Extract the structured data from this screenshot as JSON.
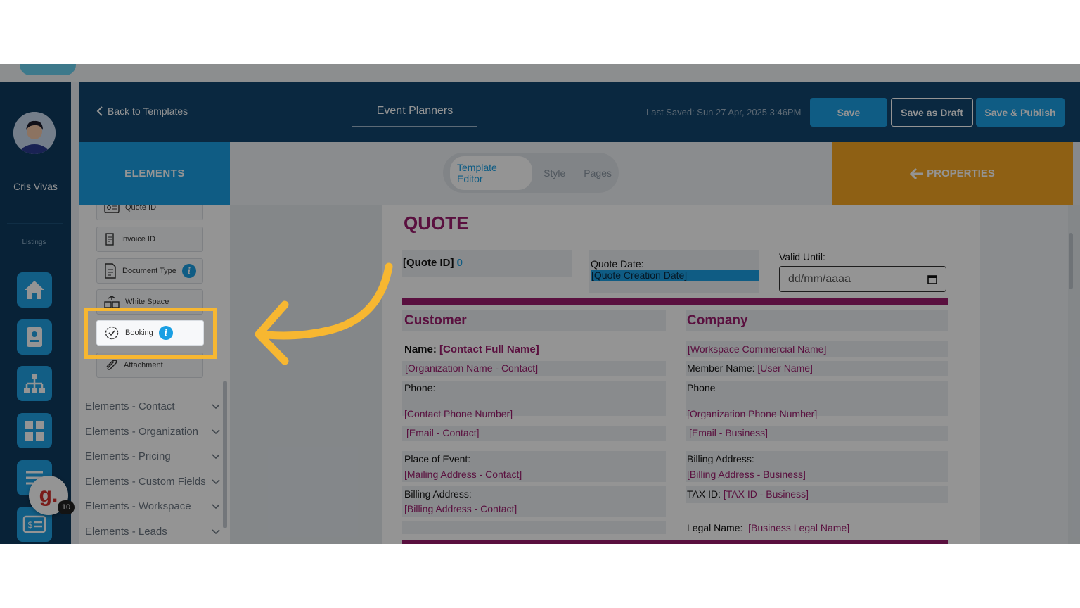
{
  "user": {
    "name": "Cris Vivas"
  },
  "rail": {
    "listings_label": "Listings",
    "badge_count": "10",
    "badge_letter": "g."
  },
  "header": {
    "back_label": "Back to Templates",
    "doc_title": "Event Planners",
    "last_saved": "Last Saved: Sun 27 Apr, 2025 3:46PM",
    "save": "Save",
    "save_draft": "Save as Draft",
    "save_publish": "Save & Publish"
  },
  "tabs": {
    "elements": "ELEMENTS",
    "template_editor": "Template Editor",
    "style": "Style",
    "pages": "Pages",
    "properties": "PROPERTIES"
  },
  "elements": {
    "items": [
      "Quote ID",
      "Invoice ID",
      "Document Type",
      "White Space",
      "Booking",
      "Attachment"
    ],
    "sections": [
      "Elements - Contact",
      "Elements - Organization",
      "Elements - Pricing",
      "Elements - Custom Fields",
      "Elements - Workspace",
      "Elements - Leads"
    ]
  },
  "quote": {
    "title": "QUOTE",
    "quote_id": "[Quote ID]",
    "quote_id_value": "0",
    "quote_date_label": "Quote Date:",
    "quote_date_value": "[Quote Creation Date]",
    "valid_until_label": "Valid Until:",
    "valid_until_placeholder": "dd/mm/aaaa",
    "customer": {
      "heading": "Customer",
      "name_label": "Name:",
      "name_value": "[Contact Full Name]",
      "org": "[Organization Name - Contact]",
      "phone_label": "Phone:",
      "phone_value": "[Contact Phone Number]",
      "email": "[Email - Contact]",
      "place_label": "Place of Event:",
      "place_value": "[Mailing Address - Contact]",
      "billing_label": "Billing Address:",
      "billing_value": "[Billing Address - Contact]"
    },
    "company": {
      "heading": "Company",
      "workspace": "[Workspace Commercial Name]",
      "member_label": "Member Name:",
      "member_value": "[User Name]",
      "phone_label": "Phone",
      "phone_value": "[Organization Phone Number]",
      "email": "[Email - Business]",
      "billing_label": "Billing Address:",
      "billing_value": "[Billing Address - Business]",
      "tax_label": "TAX ID:",
      "tax_value": "[TAX ID - Business]",
      "legal_label": "Legal Name:",
      "legal_value": "[Business Legal Name]"
    }
  },
  "colors": {
    "brand_blue": "#1a9fe3",
    "magenta": "#9b1c6d",
    "orange": "#f5a623",
    "navy": "#12466f",
    "annotation": "#f7b731"
  }
}
